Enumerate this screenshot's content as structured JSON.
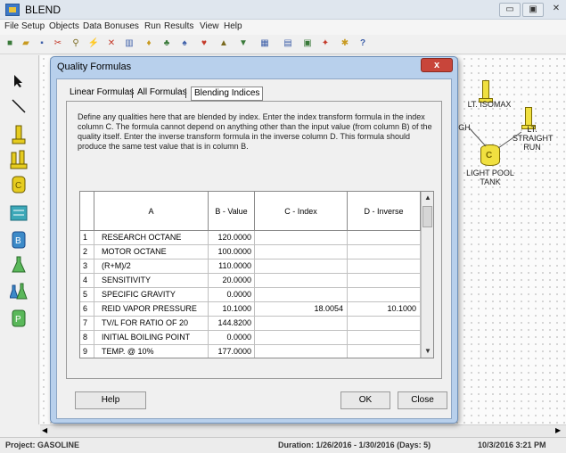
{
  "app": {
    "title": "BLEND"
  },
  "window_controls": {
    "minimize": "▭",
    "maximize": "▣",
    "close": "✕"
  },
  "menu": [
    "File",
    "Setup",
    "Objects",
    "Data",
    "Bonuses",
    "Run",
    "Results",
    "View",
    "Help"
  ],
  "toolbar": {
    "icons": [
      "new-icon",
      "open-icon",
      "save-icon",
      "cut-icon",
      "copy-icon",
      "paste-icon",
      "delete-icon",
      "chart-icon",
      "help-icon"
    ]
  },
  "palette": {
    "icons": [
      "arrow-icon",
      "line-icon",
      "tower-icon",
      "twin-tower-icon",
      "tank-icon",
      "network-icon",
      "blender-icon",
      "flask-icon",
      "flasks-icon",
      "product-icon"
    ]
  },
  "canvas": {
    "nodes": [
      {
        "label": "LT. ISOMAX"
      },
      {
        "label": "GH"
      },
      {
        "label": "LT.\nSTRAIGHT\nRUN"
      },
      {
        "label": "LIGHT POOL\nTANK"
      }
    ],
    "tank_glyph": "C"
  },
  "statusbar": {
    "project": "Project:  GASOLINE",
    "duration": "Duration:  1/26/2016 - 1/30/2016  (Days: 5)",
    "datetime": "10/3/2016 3:21 PM"
  },
  "dialog": {
    "title": "Quality Formulas",
    "close_label": "x",
    "tabs": [
      "Linear Formulas",
      "All Formulas",
      "Blending Indices"
    ],
    "active_tab": "Blending Indices",
    "description": "Define any qualities here that are blended by index.  Enter the index transform formula in the index column C.  The formula cannot depend on anything other than the input value (from column B) of the quality itself.  Enter the inverse transform formula in the inverse column D.  This formula should produce the same test value that is in column B.",
    "grid": {
      "headers": [
        "",
        "A",
        "B - Value",
        "C - Index",
        "D - Inverse"
      ],
      "rows": [
        {
          "num": "1",
          "a": "RESEARCH OCTANE",
          "b": "120.0000",
          "c": "",
          "d": ""
        },
        {
          "num": "2",
          "a": "MOTOR OCTANE",
          "b": "100.0000",
          "c": "",
          "d": ""
        },
        {
          "num": "3",
          "a": "(R+M)/2",
          "b": "110.0000",
          "c": "",
          "d": ""
        },
        {
          "num": "4",
          "a": "SENSITIVITY",
          "b": "20.0000",
          "c": "",
          "d": ""
        },
        {
          "num": "5",
          "a": "SPECIFIC GRAVITY",
          "b": "0.0000",
          "c": "",
          "d": ""
        },
        {
          "num": "6",
          "a": "REID VAPOR PRESSURE",
          "b": "10.1000",
          "c": "18.0054",
          "d": "10.1000"
        },
        {
          "num": "7",
          "a": "TV/L FOR RATIO OF 20",
          "b": "144.8200",
          "c": "",
          "d": ""
        },
        {
          "num": "8",
          "a": "INITIAL BOILING POINT",
          "b": "0.0000",
          "c": "",
          "d": ""
        },
        {
          "num": "9",
          "a": "TEMP. @ 10%",
          "b": "177.0000",
          "c": "",
          "d": ""
        }
      ]
    },
    "buttons": {
      "help": "Help",
      "ok": "OK",
      "close": "Close"
    }
  }
}
